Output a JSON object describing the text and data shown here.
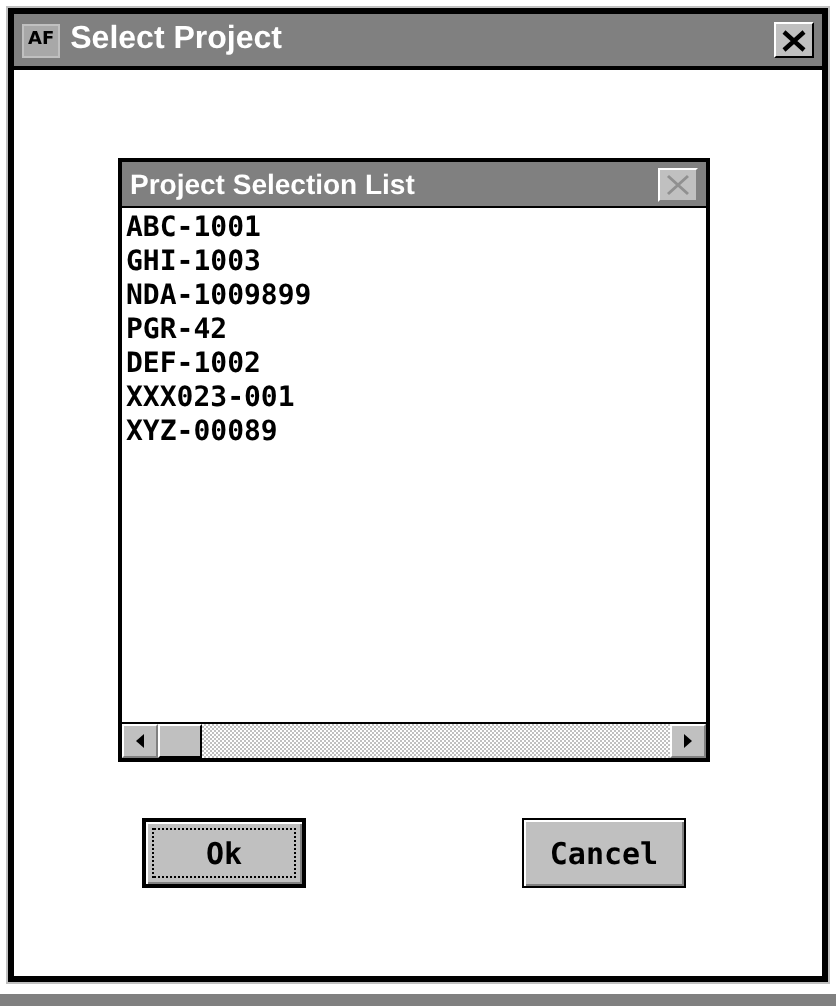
{
  "window": {
    "icon_label": "AF",
    "title": "Select Project"
  },
  "list_panel": {
    "title": "Project Selection List",
    "close_disabled": true,
    "items": [
      {
        "label": "ABC-1001",
        "selected": false
      },
      {
        "label": "GHI-1003",
        "selected": false
      },
      {
        "label": "NDA-1009899",
        "selected": false
      },
      {
        "label": "PGR-42",
        "selected": false
      },
      {
        "label": "DEF-1002",
        "selected": false
      },
      {
        "label": "XXX023-001",
        "selected": false
      },
      {
        "label": "XYZ-00089",
        "selected": false
      }
    ]
  },
  "buttons": [
    {
      "label": "Ok",
      "default": true
    },
    {
      "label": "Cancel",
      "default": false
    }
  ]
}
